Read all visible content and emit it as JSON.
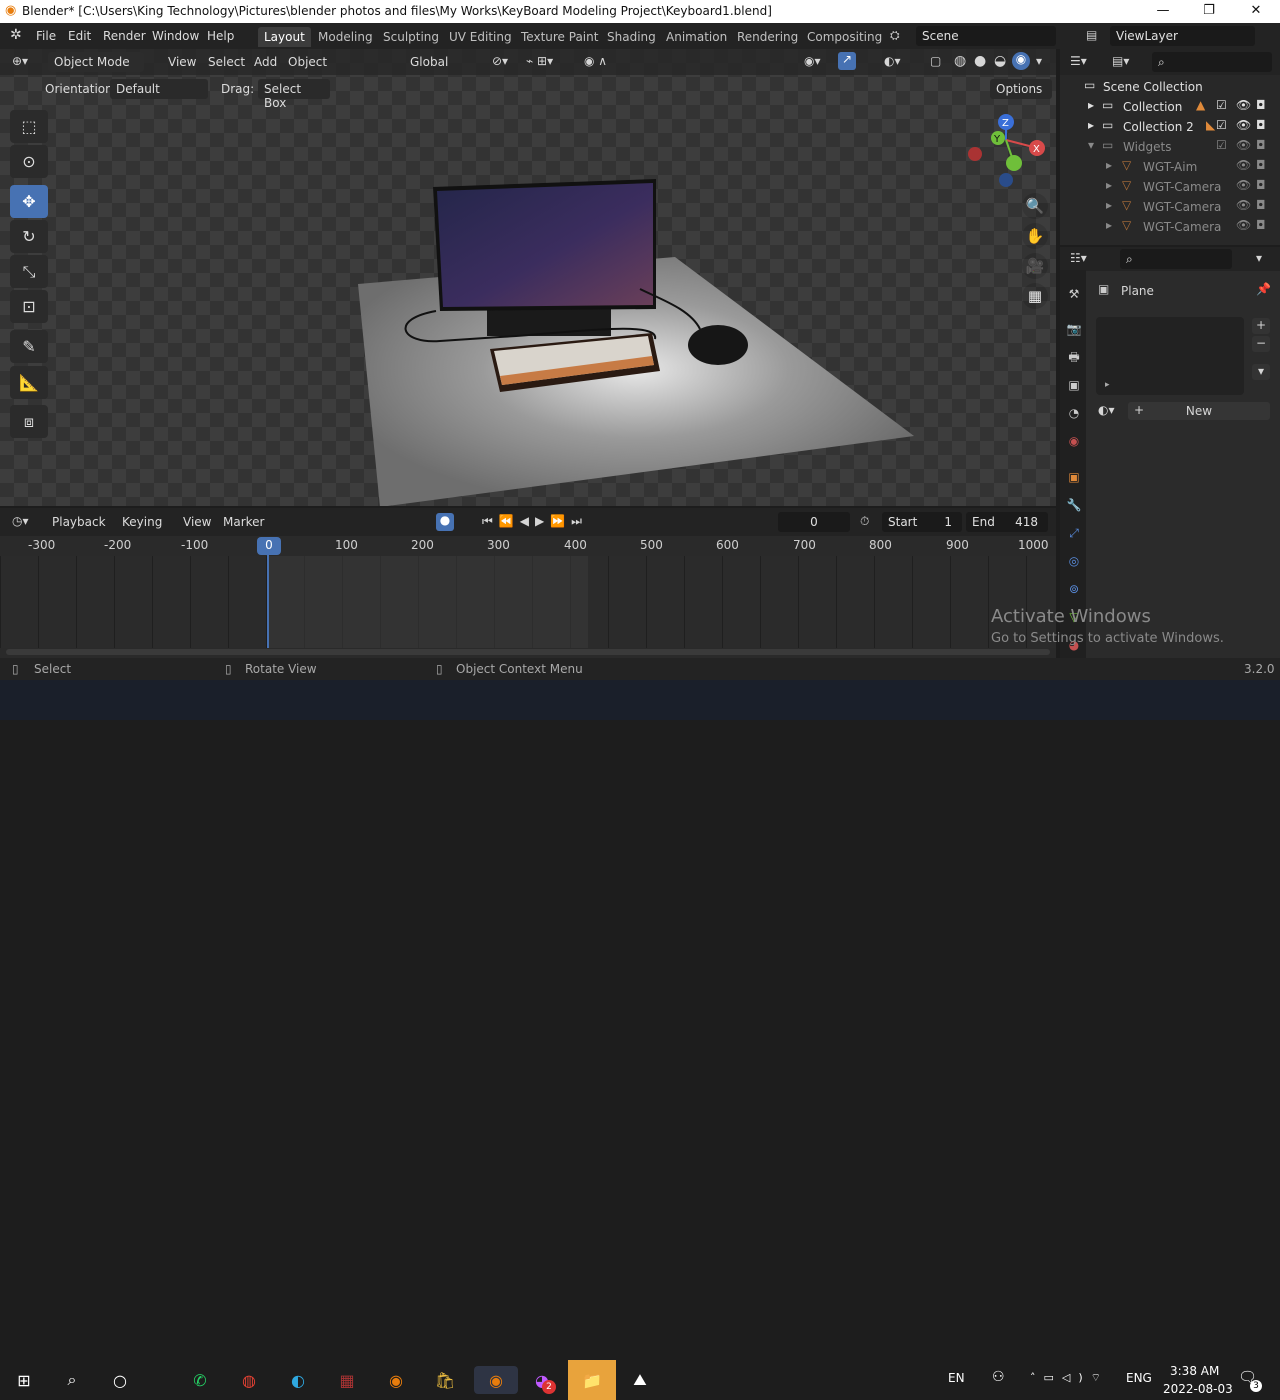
{
  "window": {
    "title": "Blender* [C:\\Users\\King Technology\\Pictures\\blender photos and files\\My Works\\KeyBoard Modeling Project\\Keyboard1.blend]",
    "min": "—",
    "max": "❐",
    "close": "✕"
  },
  "menu": {
    "items": [
      "File",
      "Edit",
      "Render",
      "Window",
      "Help"
    ],
    "workspaces": [
      "Layout",
      "Modeling",
      "Sculpting",
      "UV Editing",
      "Texture Paint",
      "Shading",
      "Animation",
      "Rendering",
      "Compositing"
    ],
    "scene": "Scene",
    "viewlayer": "ViewLayer"
  },
  "viewport": {
    "mode": "Object Mode",
    "menus": [
      "View",
      "Select",
      "Add",
      "Object"
    ],
    "orientation_label": "Orientation:",
    "orientation": "Default",
    "drag_label": "Drag:",
    "drag": "Select Box",
    "global": "Global",
    "options": "Options"
  },
  "timeline": {
    "menus": [
      "Playback",
      "Keying",
      "View",
      "Marker"
    ],
    "current_frame": "0",
    "start_label": "Start",
    "start": "1",
    "end_label": "End",
    "end": "418",
    "ruler": [
      "-300",
      "-200",
      "-100",
      "0",
      "100",
      "200",
      "300",
      "400",
      "500",
      "600",
      "700",
      "800",
      "900",
      "1000"
    ]
  },
  "outliner": {
    "rows": [
      {
        "label": "Scene Collection"
      },
      {
        "label": "Collection"
      },
      {
        "label": "Collection 2"
      },
      {
        "label": "Widgets"
      },
      {
        "label": "WGT-Aim"
      },
      {
        "label": "WGT-Camera"
      },
      {
        "label": "WGT-Camera"
      },
      {
        "label": "WGT-Camera"
      }
    ]
  },
  "properties": {
    "object": "Plane",
    "new_label": "New"
  },
  "status": {
    "select": "Select",
    "rotate": "Rotate View",
    "context": "Object Context Menu",
    "version": "3.2.0"
  },
  "watermark": {
    "line1": "Activate Windows",
    "line2": "Go to Settings to activate Windows."
  },
  "taskbar": {
    "lang": "EN",
    "ime": "ENG",
    "time": "3:38 AM",
    "date": "2022-08-03",
    "notif": "3",
    "chrome_badge": "2"
  },
  "colors": {
    "accent": "#4772b3",
    "header": "#232323"
  }
}
